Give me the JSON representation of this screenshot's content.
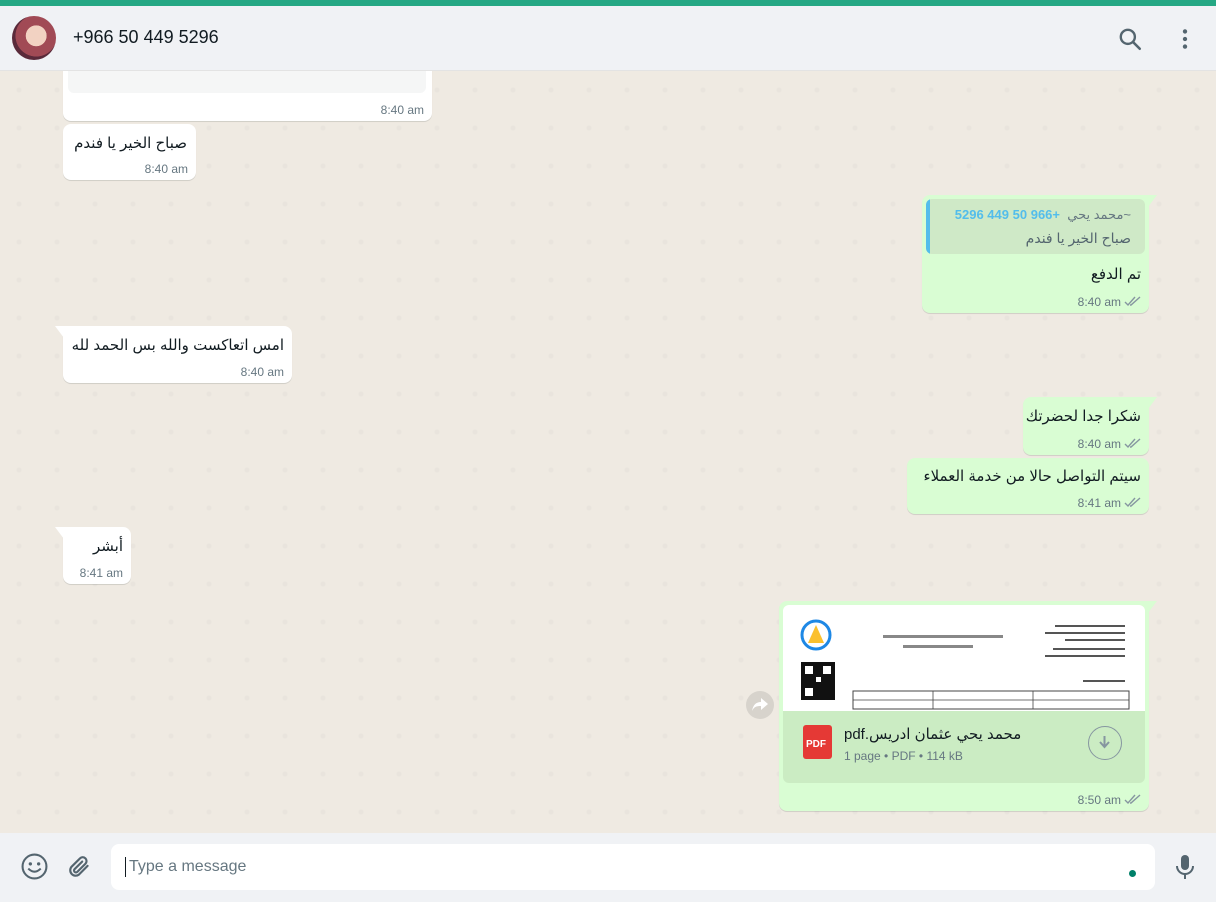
{
  "header": {
    "contact_name": "+966 50 449 5296",
    "icons": [
      "search-icon",
      "menu-icon"
    ]
  },
  "messages": [
    {
      "direction": "in",
      "time": "8:40 am",
      "text": ""
    },
    {
      "direction": "in",
      "text": "صباح الخير يا فندم",
      "time": "8:40 am"
    },
    {
      "direction": "out",
      "quote_author": "~محمد يحي",
      "quote_phone": "+966 50 449 5296",
      "quote_text": "صباح الخير يا فندم",
      "text": "تم الدفع",
      "time": "8:40 am"
    },
    {
      "direction": "in",
      "text": "امس اتعاكست والله بس الحمد لله",
      "time": "8:40 am"
    },
    {
      "direction": "out",
      "text": "شكرا جدا لحضرتك",
      "time": "8:40 am"
    },
    {
      "direction": "out",
      "text": "سيتم التواصل حالا من خدمة العملاء",
      "time": "8:41 am"
    },
    {
      "direction": "in",
      "text": "أبشر",
      "time": "8:41 am"
    },
    {
      "direction": "out",
      "type": "document",
      "file_name": "محمد يحي عثمان ادريس.pdf",
      "file_meta": "1 page • PDF • 114 kB",
      "file_badge": "PDF",
      "time": "8:50 am"
    }
  ],
  "composer": {
    "placeholder": "Type a message",
    "icons": [
      "emoji-icon",
      "attach-icon",
      "mic-icon"
    ]
  },
  "colors": {
    "accent": "#25a884",
    "incoming_bubble": "#ffffff",
    "outgoing_bubble": "#d9fdd3",
    "quote_bar": "#53bdeb",
    "read_ticks": "#8696a0",
    "pdf_red": "#e53935"
  }
}
